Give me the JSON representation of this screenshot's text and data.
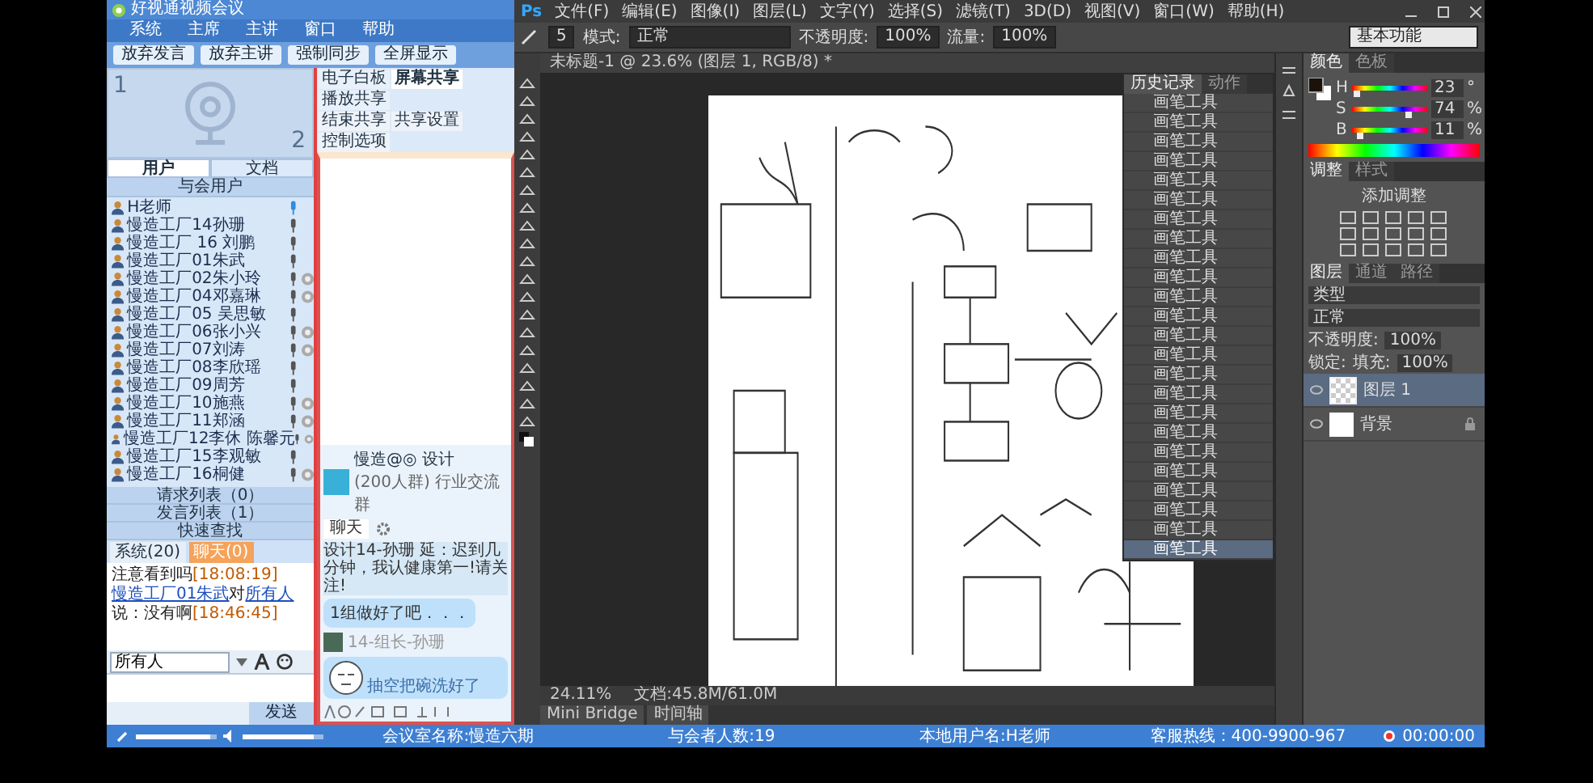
{
  "meeting": {
    "title": "好视通视频会议",
    "menu": [
      "系统",
      "主席",
      "主讲",
      "窗口",
      "帮助"
    ],
    "toolbar": [
      "放弃发言",
      "放弃主讲",
      "强制同步",
      "全屏显示"
    ],
    "video_slots": [
      "1",
      "2"
    ],
    "tabs": [
      {
        "label": "用户",
        "selected": true
      },
      {
        "label": "文档",
        "selected": false
      }
    ],
    "users_header": "与会用户",
    "users": [
      {
        "name": "H老师",
        "speaking": true,
        "camera": false
      },
      {
        "name": "慢造工厂14孙珊",
        "speaking": false,
        "camera": false
      },
      {
        "name": "慢造工厂 16 刘鹏",
        "speaking": false,
        "camera": false
      },
      {
        "name": "慢造工厂01朱武",
        "speaking": false,
        "camera": false
      },
      {
        "name": "慢造工厂02朱小玲",
        "speaking": false,
        "camera": true
      },
      {
        "name": "慢造工厂04邓嘉琳",
        "speaking": false,
        "camera": true
      },
      {
        "name": "慢造工厂05 吴思敏",
        "speaking": false,
        "camera": false
      },
      {
        "name": "慢造工厂06张小兴",
        "speaking": false,
        "camera": true
      },
      {
        "name": "慢造工厂07刘涛",
        "speaking": false,
        "camera": true
      },
      {
        "name": "慢造工厂08李欣瑶",
        "speaking": false,
        "camera": false
      },
      {
        "name": "慢造工厂09周芳",
        "speaking": false,
        "camera": false
      },
      {
        "name": "慢造工厂10施燕",
        "speaking": false,
        "camera": true
      },
      {
        "name": "慢造工厂11郑涵",
        "speaking": false,
        "camera": true
      },
      {
        "name": "慢造工厂12李休 陈馨元",
        "speaking": false,
        "camera": true
      },
      {
        "name": "慢造工厂15李观敏",
        "speaking": false,
        "camera": false
      },
      {
        "name": "慢造工厂16桐健",
        "speaking": false,
        "camera": true
      }
    ],
    "lists": [
      "请求列表（0）",
      "发言列表（1）",
      "快速查找"
    ],
    "chat_tabs": [
      {
        "label": "系统(20)",
        "selected": false
      },
      {
        "label": "聊天(0)",
        "selected": true
      }
    ],
    "messages": [
      {
        "text": "注意看到吗",
        "time": "[18:08:19]"
      },
      {
        "sender": "慢造工厂01朱武",
        "to": "所有人",
        "text": "说：没有啊",
        "time": "[18:46:45]"
      }
    ],
    "to_word": "对",
    "recipient": "所有人",
    "send": "发送",
    "share_tabs": [
      {
        "label": "电子白板",
        "selected": false
      },
      {
        "label": "屏幕共享",
        "selected": true
      },
      {
        "label": "播放共享",
        "selected": false
      }
    ],
    "share_buttons": [
      "结束共享",
      "共享设置",
      "控制选项"
    ],
    "group_chat": {
      "name": "慢造@◎ 设计",
      "info": "(200人群) 行业交流群",
      "tab": "聊天",
      "notice": "设计14-孙珊 延：迟到几分钟，我认健康第一!请关注!",
      "messages": [
        {
          "kind": "text",
          "text": "1组做好了吧．．．"
        },
        {
          "kind": "sticker",
          "author": "14-组长-孙珊",
          "text": "抽空把碗洗好了"
        }
      ]
    }
  },
  "photoshop": {
    "logo": "Ps",
    "menu": [
      "文件(F)",
      "编辑(E)",
      "图像(I)",
      "图层(L)",
      "文字(Y)",
      "选择(S)",
      "滤镜(T)",
      "3D(D)",
      "视图(V)",
      "窗口(W)",
      "帮助(H)"
    ],
    "options": {
      "size": "5",
      "mode_label": "模式:",
      "mode": "正常",
      "opacity_label": "不透明度:",
      "opacity": "100%",
      "flow_label": "流量:",
      "flow": "100%",
      "workspace": "基本功能"
    },
    "doc_tab": "未标题-1 @ 23.6% (图层 1, RGB/8) *",
    "zoom": "24.11%",
    "doc_size": "文档:45.8M/61.0M",
    "bottom_tabs": [
      "Mini Bridge",
      "时间轴"
    ],
    "history": {
      "tabs": [
        {
          "label": "历史记录",
          "selected": true
        },
        {
          "label": "动作",
          "selected": false
        }
      ],
      "items": [
        {
          "label": "画笔工具",
          "selected": false
        },
        {
          "label": "画笔工具",
          "selected": false
        },
        {
          "label": "画笔工具",
          "selected": false
        },
        {
          "label": "画笔工具",
          "selected": false
        },
        {
          "label": "画笔工具",
          "selected": false
        },
        {
          "label": "画笔工具",
          "selected": false
        },
        {
          "label": "画笔工具",
          "selected": false
        },
        {
          "label": "画笔工具",
          "selected": false
        },
        {
          "label": "画笔工具",
          "selected": false
        },
        {
          "label": "画笔工具",
          "selected": false
        },
        {
          "label": "画笔工具",
          "selected": false
        },
        {
          "label": "画笔工具",
          "selected": false
        },
        {
          "label": "画笔工具",
          "selected": false
        },
        {
          "label": "画笔工具",
          "selected": false
        },
        {
          "label": "画笔工具",
          "selected": false
        },
        {
          "label": "画笔工具",
          "selected": false
        },
        {
          "label": "画笔工具",
          "selected": false
        },
        {
          "label": "画笔工具",
          "selected": false
        },
        {
          "label": "画笔工具",
          "selected": false
        },
        {
          "label": "画笔工具",
          "selected": false
        },
        {
          "label": "画笔工具",
          "selected": false
        },
        {
          "label": "画笔工具",
          "selected": false
        },
        {
          "label": "画笔工具",
          "selected": false
        },
        {
          "label": "画笔工具",
          "selected": true
        }
      ]
    },
    "color": {
      "tabs": [
        {
          "label": "颜色",
          "selected": true
        },
        {
          "label": "色板",
          "selected": false
        }
      ],
      "channels": [
        {
          "name": "H",
          "value": "23",
          "unit": "°",
          "level": 0.06
        },
        {
          "name": "S",
          "value": "74",
          "unit": "%",
          "level": 0.74
        },
        {
          "name": "B",
          "value": "11",
          "unit": "%",
          "level": 0.11
        }
      ]
    },
    "adjustments": {
      "tabs": [
        {
          "label": "调整",
          "selected": true
        },
        {
          "label": "样式",
          "selected": false
        }
      ],
      "label": "添加调整"
    },
    "layers": {
      "tabs": [
        {
          "label": "图层",
          "selected": true
        },
        {
          "label": "通道",
          "selected": false
        },
        {
          "label": "路径",
          "selected": false
        }
      ],
      "filter": "类型",
      "blend": "正常",
      "opacity_label": "不透明度:",
      "opacity": "100%",
      "lock_label": "锁定:",
      "fill_label": "填充:",
      "fill": "100%",
      "items": [
        {
          "name": "图层 1",
          "kind": "transparent",
          "selected": true,
          "locked": false
        },
        {
          "name": "背景",
          "kind": "white",
          "selected": false,
          "locked": true
        }
      ]
    }
  },
  "status_bar": {
    "mic_slider": {
      "level": 0.92
    },
    "speaker_slider": {
      "level": 0.88
    },
    "items": [
      "会议室名称:慢造六期",
      "与会者人数:19",
      "本地用户名:H老师",
      "客服热线：400-9900-967"
    ],
    "timer": "00:00:00"
  }
}
